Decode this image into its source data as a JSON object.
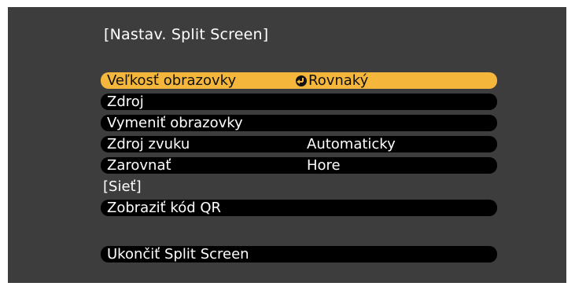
{
  "menu": {
    "title": "[Nastav. Split Screen]",
    "items": [
      {
        "label": "Veľkosť obrazovky",
        "value": "Rovnaký",
        "selected": true
      },
      {
        "label": "Zdroj",
        "value": ""
      },
      {
        "label": "Vymeniť obrazovky",
        "value": ""
      },
      {
        "label": "Zdroj zvuku",
        "value": "Automaticky"
      },
      {
        "label": "Zarovnať",
        "value": "Hore"
      }
    ],
    "network_section": "[Sieť]",
    "qr_button": "Zobraziť kód QR",
    "exit_button": "Ukončiť Split Screen"
  },
  "colors": {
    "background": "#3d3d3d",
    "row": "#000000",
    "highlight": "#f5b73b",
    "text": "#ffffff"
  },
  "icons": {
    "selected_row_value": "enter-icon"
  }
}
